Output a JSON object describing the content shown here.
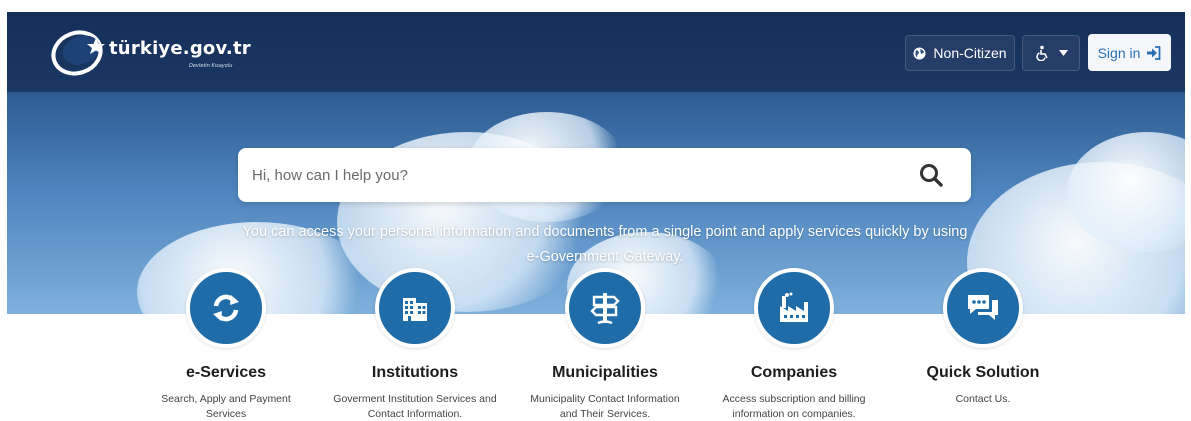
{
  "header": {
    "logo_text": "türkiye.gov.tr",
    "logo_sub": "Devletin Kısayolu",
    "noncitizen_label": "Non-Citizen",
    "signin_label": "Sign in"
  },
  "search": {
    "placeholder": "Hi, how can I help you?"
  },
  "tagline": "You can access your personal information and documents from a single point and apply services quickly by using e-Government Gateway.",
  "cards": [
    {
      "title": "e-Services",
      "desc": "Search, Apply and Payment Services",
      "icon": "refresh-icon"
    },
    {
      "title": "Institutions",
      "desc": "Goverment Institution Services and Contact Information.",
      "icon": "building-icon"
    },
    {
      "title": "Municipalities",
      "desc": "Municipality Contact Information and Their Services.",
      "icon": "signpost-icon"
    },
    {
      "title": "Companies",
      "desc": "Access subscription and billing information on companies.",
      "icon": "factory-icon"
    },
    {
      "title": "Quick Solution",
      "desc": "Contact Us.",
      "icon": "chat-icon"
    }
  ],
  "colors": {
    "accent": "#1f6ca8",
    "signin_text": "#2a6fb6"
  }
}
